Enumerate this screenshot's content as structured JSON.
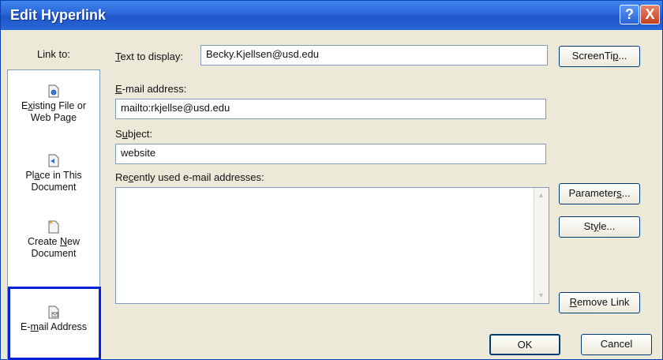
{
  "window": {
    "title": "Edit Hyperlink",
    "help_glyph": "?",
    "close_glyph": "X"
  },
  "labels": {
    "link_to": "Link to:",
    "text_to_display_key": "T",
    "text_to_display_rest": "ext to display:",
    "email_key": "E",
    "email_rest": "-mail address:",
    "subject_pre": "S",
    "subject_key": "u",
    "subject_rest": "bject:",
    "recent_pre": "Re",
    "recent_key": "c",
    "recent_rest": "ently used e-mail addresses:"
  },
  "fields": {
    "text_to_display": "Becky.Kjellsen@usd.edu",
    "email_address": "mailto:rkjellse@usd.edu",
    "subject": "website"
  },
  "nav": {
    "existing_pre": "E",
    "existing_key": "x",
    "existing_rest": "isting File or",
    "existing_line2": "Web Page",
    "place_pre": "Pl",
    "place_key": "a",
    "place_rest": "ce in This",
    "place_line2": "Document",
    "create_line1": "Create ",
    "create_key": "N",
    "create_rest": "ew",
    "create_line2": "Document",
    "email_pre": "E-",
    "email_key": "m",
    "email_rest": "ail Address"
  },
  "buttons": {
    "screentip_pre": "ScreenTi",
    "screentip_key": "p",
    "screentip_rest": "...",
    "parameters_pre": "Parameter",
    "parameters_key": "s",
    "parameters_rest": "...",
    "style_pre": "St",
    "style_key": "y",
    "style_rest": "le...",
    "remove_key": "R",
    "remove_rest": "emove Link",
    "ok": "OK",
    "cancel": "Cancel"
  }
}
